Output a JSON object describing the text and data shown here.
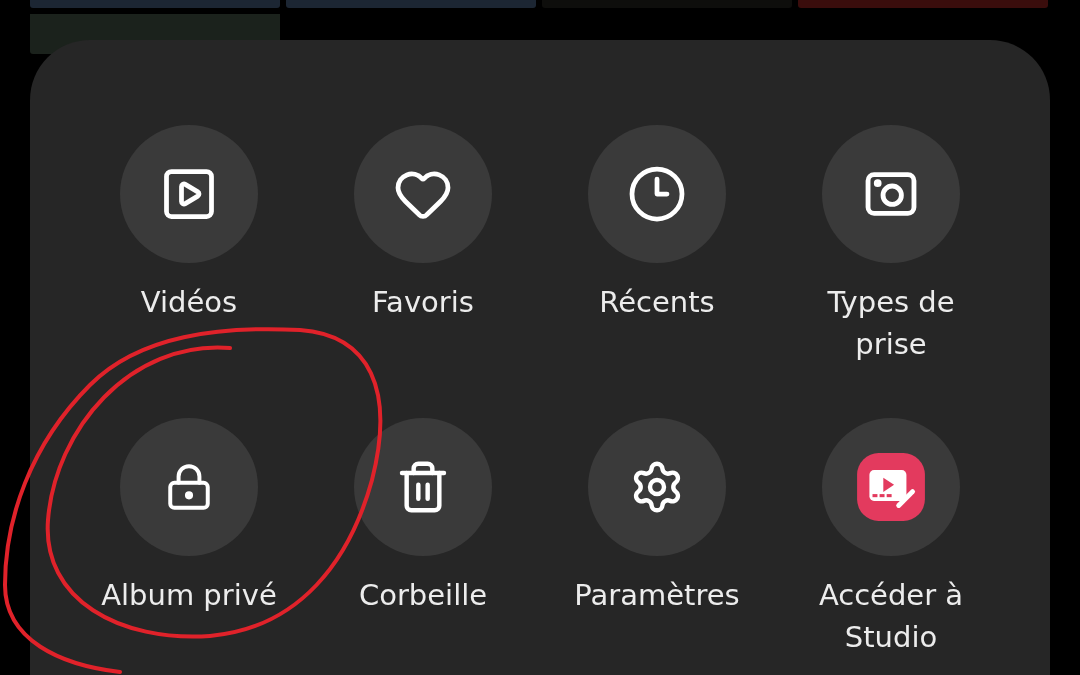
{
  "menu": {
    "items": [
      {
        "kind": "videos",
        "label": "Vidéos"
      },
      {
        "kind": "favorites",
        "label": "Favoris"
      },
      {
        "kind": "recent",
        "label": "Récents"
      },
      {
        "kind": "capture",
        "label": "Types de prise"
      },
      {
        "kind": "private",
        "label": "Album privé"
      },
      {
        "kind": "trash",
        "label": "Corbeille"
      },
      {
        "kind": "settings",
        "label": "Paramètres"
      },
      {
        "kind": "studio",
        "label": "Accéder à Studio"
      }
    ]
  }
}
